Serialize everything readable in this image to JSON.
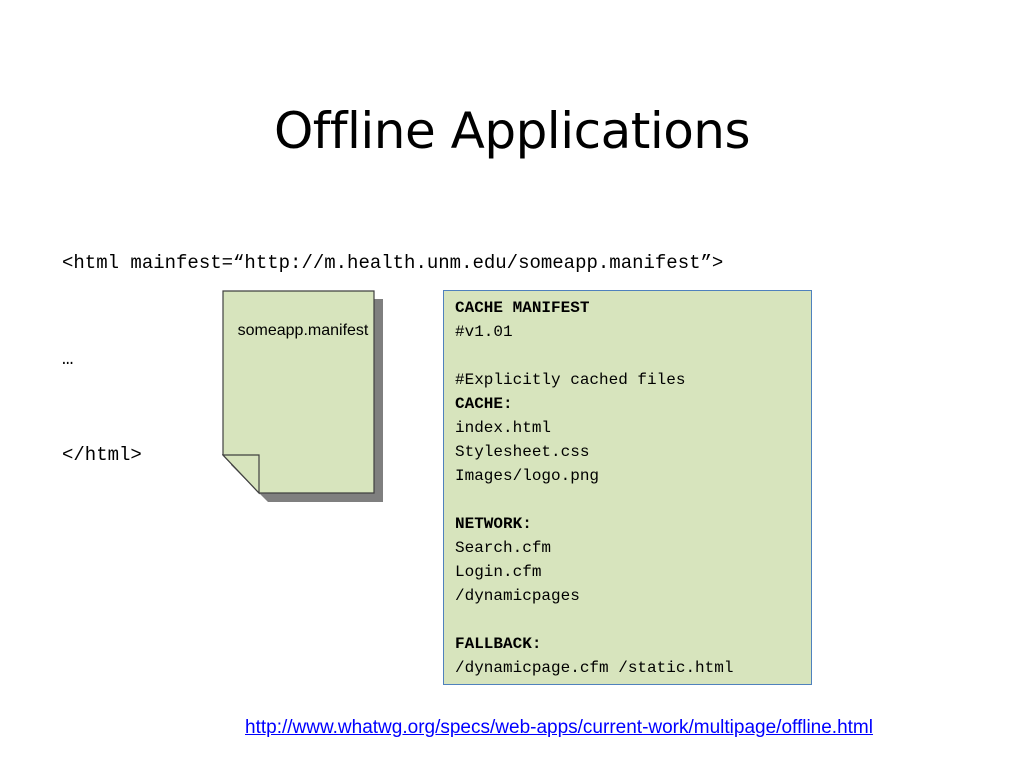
{
  "slide": {
    "title": "Offline Applications"
  },
  "html_snippet": {
    "lines": [
      "<html mainfest=“http://m.health.unm.edu/someapp.manifest”>",
      "…",
      "</html>"
    ]
  },
  "document_icon": {
    "label": "someapp.manifest",
    "fill_color": "#d7e4bd",
    "shadow_color": "#7f7f7f"
  },
  "manifest": {
    "background_color": "#d7e4bd",
    "border_color": "#4f81bd",
    "lines": [
      {
        "text": "CACHE MANIFEST",
        "bold": true
      },
      {
        "text": "#v1.01",
        "bold": false
      },
      {
        "text": "",
        "bold": false
      },
      {
        "text": "#Explicitly cached files",
        "bold": false
      },
      {
        "text": "CACHE:",
        "bold": true
      },
      {
        "text": "index.html",
        "bold": false
      },
      {
        "text": "Stylesheet.css",
        "bold": false
      },
      {
        "text": "Images/logo.png",
        "bold": false
      },
      {
        "text": "",
        "bold": false
      },
      {
        "text": "NETWORK:",
        "bold": true
      },
      {
        "text": "Search.cfm",
        "bold": false
      },
      {
        "text": "Login.cfm",
        "bold": false
      },
      {
        "text": "/dynamicpages",
        "bold": false
      },
      {
        "text": "",
        "bold": false
      },
      {
        "text": "FALLBACK:",
        "bold": true
      },
      {
        "text": "/dynamicpage.cfm /static.html",
        "bold": false
      }
    ]
  },
  "reference": {
    "url": "http://www.whatwg.org/specs/web-apps/current-work/multipage/offline.html",
    "link_color": "#0000ff"
  }
}
